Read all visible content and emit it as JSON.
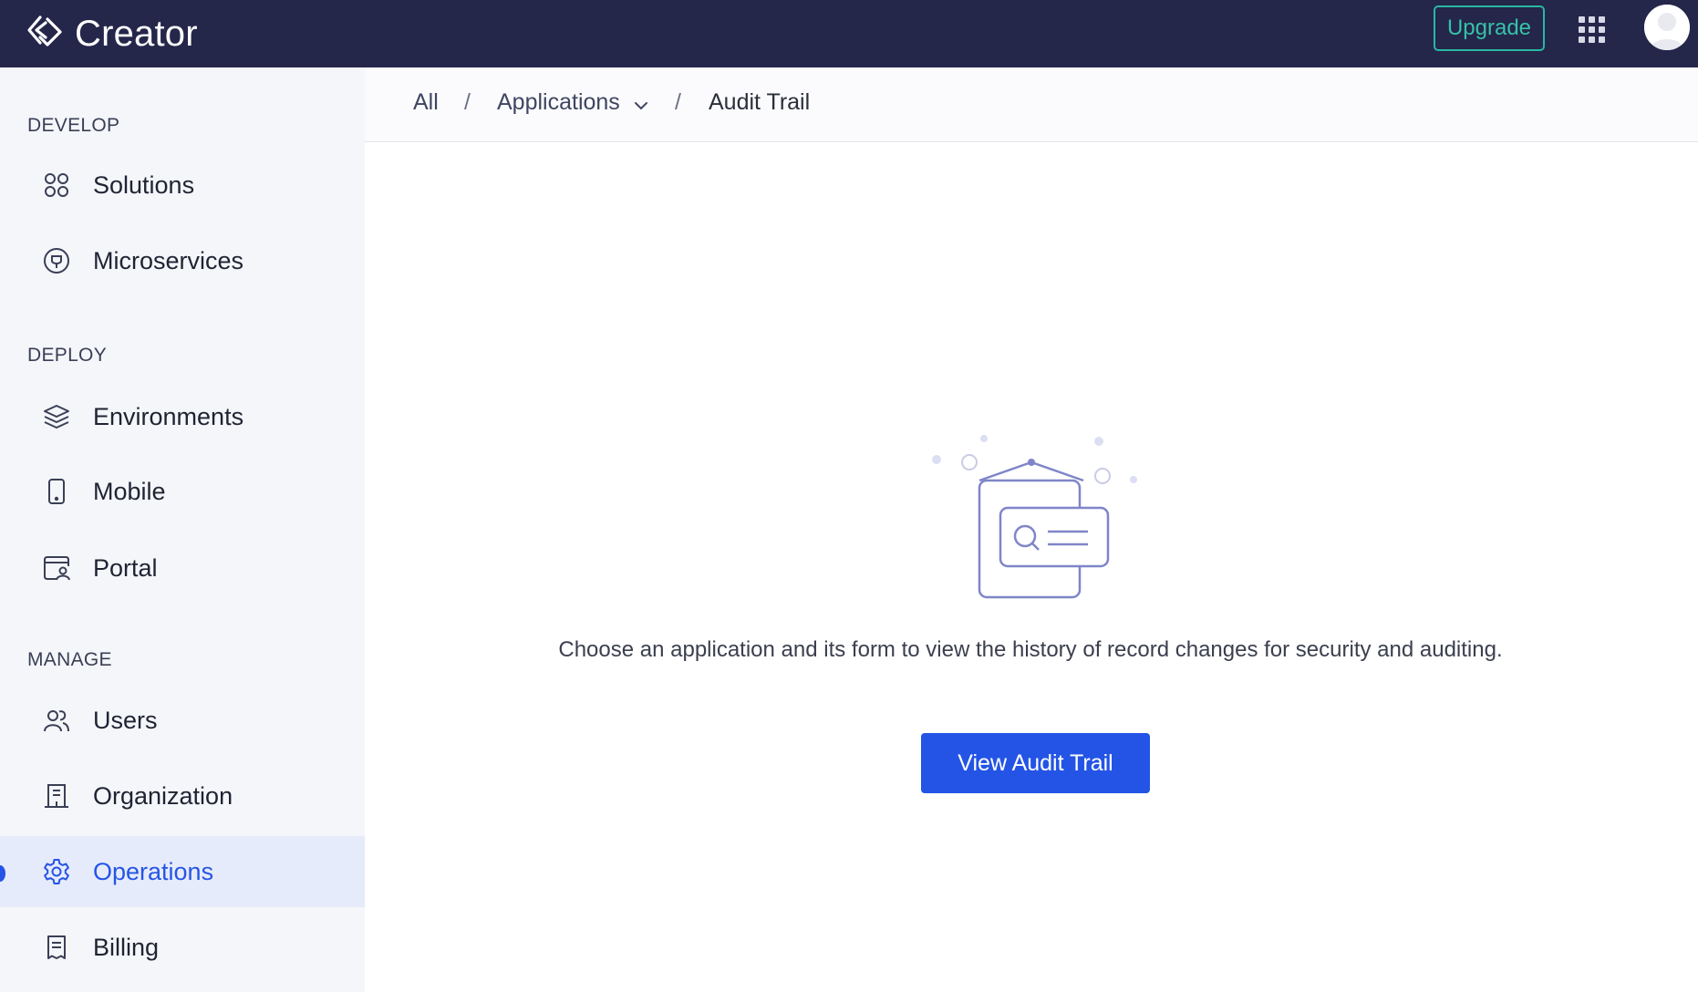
{
  "app": {
    "title": "Creator",
    "upgrade_label": "Upgrade"
  },
  "icons": {
    "logo": "creator-logo-icon",
    "apps": "grid-apps-icon",
    "avatar": "user-avatar-icon"
  },
  "colors": {
    "topbar": "#24264a",
    "accent": "#2454e6",
    "upgrade": "#2ab7a1",
    "sidebar_bg": "#f5f6fa",
    "active_bg": "#e6ebfb"
  },
  "sidebar": {
    "sections": [
      {
        "title": "DEVELOP",
        "items": [
          {
            "label": "Solutions",
            "icon": "solutions-icon"
          },
          {
            "label": "Microservices",
            "icon": "microservices-icon"
          }
        ]
      },
      {
        "title": "DEPLOY",
        "items": [
          {
            "label": "Environments",
            "icon": "layers-icon"
          },
          {
            "label": "Mobile",
            "icon": "mobile-icon"
          },
          {
            "label": "Portal",
            "icon": "portal-icon"
          }
        ]
      },
      {
        "title": "MANAGE",
        "items": [
          {
            "label": "Users",
            "icon": "users-icon"
          },
          {
            "label": "Organization",
            "icon": "building-icon"
          },
          {
            "label": "Operations",
            "icon": "gear-icon",
            "active": true
          },
          {
            "label": "Billing",
            "icon": "receipt-icon"
          }
        ]
      }
    ]
  },
  "breadcrumb": {
    "items": [
      "All",
      "Applications",
      "Audit Trail"
    ],
    "separator": "/"
  },
  "main": {
    "description": "Choose an application and its form to view the history of record changes for security and auditing.",
    "button_label": "View Audit Trail",
    "illustration_icon": "audit-card-illustration-icon"
  }
}
